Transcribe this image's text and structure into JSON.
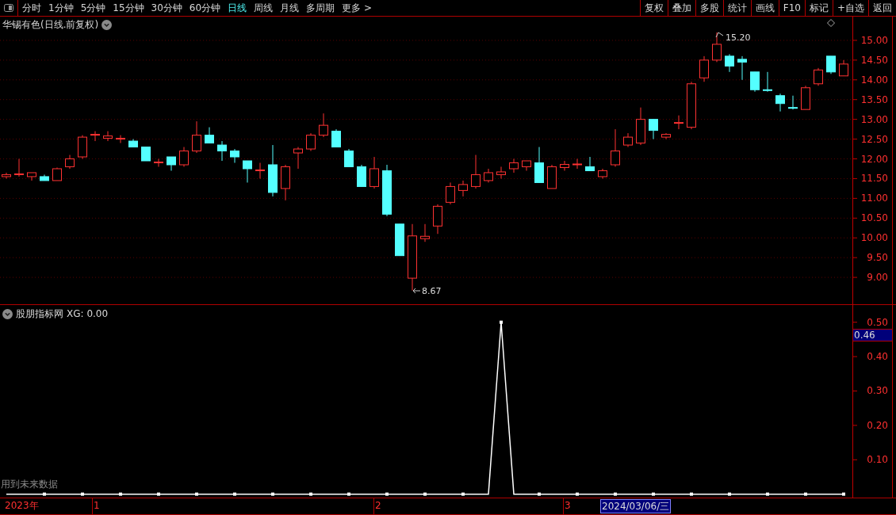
{
  "toolbar": {
    "periods": [
      {
        "label": "分时",
        "selected": false
      },
      {
        "label": "1分钟",
        "selected": false
      },
      {
        "label": "5分钟",
        "selected": false
      },
      {
        "label": "15分钟",
        "selected": false
      },
      {
        "label": "30分钟",
        "selected": false
      },
      {
        "label": "60分钟",
        "selected": false
      },
      {
        "label": "日线",
        "selected": true
      },
      {
        "label": "周线",
        "selected": false
      },
      {
        "label": "月线",
        "selected": false
      },
      {
        "label": "多周期",
        "selected": false
      },
      {
        "label": "更多 >",
        "selected": false
      }
    ],
    "buttons": [
      "复权",
      "叠加",
      "多股",
      "统计",
      "画线",
      "F10",
      "标记",
      "+自选",
      "返回"
    ]
  },
  "main_chart": {
    "title": "华锡有色(日线.前复权)",
    "high_label": "15.20",
    "low_label": "8.67",
    "chart_data": {
      "type": "candlestick",
      "ylim": [
        8.3,
        15.6
      ],
      "yticks": [
        {
          "value": 15,
          "label": "15.00"
        },
        {
          "value": 14.5,
          "label": "14.50"
        },
        {
          "value": 14,
          "label": "14.00"
        },
        {
          "value": 13.5,
          "label": "13.50"
        },
        {
          "value": 13,
          "label": "13.00"
        },
        {
          "value": 12.5,
          "label": "12.50"
        },
        {
          "value": 12,
          "label": "12.00"
        },
        {
          "value": 11.5,
          "label": "11.50"
        },
        {
          "value": 11,
          "label": "11.00"
        },
        {
          "value": 10.5,
          "label": "10.50"
        },
        {
          "value": 10,
          "label": "10.00"
        },
        {
          "value": 9.5,
          "label": "9.50"
        },
        {
          "value": 9,
          "label": "9.00"
        }
      ],
      "grid": true,
      "ohlc": [
        [
          11.55,
          11.65,
          11.5,
          11.6
        ],
        [
          11.6,
          12.0,
          11.55,
          11.62
        ],
        [
          11.55,
          11.65,
          11.45,
          11.65
        ],
        [
          11.55,
          11.6,
          11.45,
          11.45
        ],
        [
          11.45,
          11.78,
          11.45,
          11.75
        ],
        [
          11.8,
          12.1,
          11.75,
          12.0
        ],
        [
          12.05,
          12.6,
          12.0,
          12.55
        ],
        [
          12.6,
          12.7,
          12.45,
          12.62
        ],
        [
          12.52,
          12.7,
          12.45,
          12.58
        ],
        [
          12.5,
          12.6,
          12.4,
          12.52
        ],
        [
          12.45,
          12.5,
          12.3,
          12.3
        ],
        [
          12.3,
          12.3,
          11.95,
          11.95
        ],
        [
          11.9,
          12.0,
          11.8,
          11.92
        ],
        [
          12.05,
          12.05,
          11.7,
          11.85
        ],
        [
          11.85,
          12.3,
          11.8,
          12.2
        ],
        [
          12.2,
          12.95,
          12.15,
          12.6
        ],
        [
          12.6,
          12.8,
          12.4,
          12.4
        ],
        [
          12.35,
          12.45,
          11.95,
          12.2
        ],
        [
          12.2,
          12.25,
          11.9,
          12.05
        ],
        [
          11.95,
          11.95,
          11.4,
          11.75
        ],
        [
          11.7,
          11.9,
          11.5,
          11.72
        ],
        [
          11.85,
          12.35,
          11.05,
          11.15
        ],
        [
          11.25,
          11.85,
          10.95,
          11.8
        ],
        [
          12.15,
          12.3,
          11.75,
          12.25
        ],
        [
          12.25,
          12.65,
          12.2,
          12.6
        ],
        [
          12.6,
          13.15,
          12.55,
          12.85
        ],
        [
          12.7,
          12.75,
          12.3,
          12.3
        ],
        [
          12.2,
          12.25,
          11.8,
          11.8
        ],
        [
          11.8,
          11.85,
          11.3,
          11.3
        ],
        [
          11.3,
          12.05,
          11.25,
          11.75
        ],
        [
          11.7,
          11.85,
          10.55,
          10.6
        ],
        [
          10.35,
          10.35,
          9.55,
          9.55
        ],
        [
          8.98,
          10.35,
          8.67,
          10.05
        ],
        [
          9.98,
          10.35,
          9.9,
          10.04
        ],
        [
          10.3,
          10.85,
          10.1,
          10.8
        ],
        [
          10.9,
          11.4,
          10.85,
          11.3
        ],
        [
          11.2,
          11.45,
          11.05,
          11.35
        ],
        [
          11.3,
          12.1,
          11.25,
          11.6
        ],
        [
          11.45,
          11.75,
          11.4,
          11.65
        ],
        [
          11.6,
          11.8,
          11.5,
          11.67
        ],
        [
          11.75,
          12.0,
          11.65,
          11.9
        ],
        [
          11.8,
          11.95,
          11.7,
          11.95
        ],
        [
          11.9,
          12.3,
          11.4,
          11.4
        ],
        [
          11.25,
          11.85,
          11.25,
          11.8
        ],
        [
          11.78,
          11.95,
          11.7,
          11.86
        ],
        [
          11.85,
          12.0,
          11.75,
          11.87
        ],
        [
          11.8,
          12.05,
          11.7,
          11.7
        ],
        [
          11.55,
          11.75,
          11.5,
          11.7
        ],
        [
          11.85,
          12.75,
          11.8,
          12.2
        ],
        [
          12.35,
          12.65,
          12.3,
          12.55
        ],
        [
          12.4,
          13.3,
          12.35,
          13.0
        ],
        [
          13.0,
          13.0,
          12.5,
          12.72
        ],
        [
          12.55,
          12.65,
          12.5,
          12.62
        ],
        [
          12.9,
          13.1,
          12.75,
          12.92
        ],
        [
          12.8,
          13.95,
          12.75,
          13.9
        ],
        [
          14.05,
          14.6,
          13.95,
          14.5
        ],
        [
          14.5,
          15.2,
          14.45,
          14.9
        ],
        [
          14.6,
          14.65,
          14.2,
          14.35
        ],
        [
          14.52,
          14.6,
          14.0,
          14.45
        ],
        [
          14.2,
          14.2,
          13.7,
          13.75
        ],
        [
          13.75,
          14.2,
          13.7,
          13.73
        ],
        [
          13.6,
          13.65,
          13.2,
          13.4
        ],
        [
          13.3,
          13.6,
          13.25,
          13.28
        ],
        [
          13.25,
          13.85,
          13.25,
          13.8
        ],
        [
          13.9,
          14.3,
          13.85,
          14.25
        ],
        [
          14.6,
          14.6,
          14.15,
          14.2
        ],
        [
          14.1,
          14.5,
          14.1,
          14.4
        ]
      ]
    }
  },
  "indicator": {
    "title": "股朋指标网",
    "reading": "XG: 0.00",
    "current_value": "0.46",
    "warning": "用到未来数据",
    "chart_data": {
      "type": "line",
      "ylim": [
        -0.01,
        0.55
      ],
      "yticks": [
        {
          "value": 0.1,
          "label": "0.10"
        },
        {
          "value": 0.2,
          "label": "0.20"
        },
        {
          "value": 0.3,
          "label": "0.30"
        },
        {
          "value": 0.4,
          "label": "0.40"
        },
        {
          "value": 0.5,
          "label": "0.50"
        }
      ],
      "series": [
        {
          "color": "#ffffff",
          "values": [
            0,
            0,
            0,
            0,
            0,
            0,
            0,
            0,
            0,
            0,
            0,
            0,
            0,
            0,
            0,
            0,
            0,
            0,
            0,
            0,
            0,
            0,
            0,
            0,
            0,
            0,
            0,
            0,
            0,
            0,
            0,
            0,
            0,
            0,
            0,
            0,
            0,
            0,
            0,
            0.5,
            0,
            0,
            0,
            0,
            0,
            0,
            0,
            0,
            0,
            0,
            0,
            0,
            0,
            0,
            0,
            0,
            0,
            0,
            0,
            0,
            0,
            0,
            0,
            0,
            0,
            0,
            0
          ]
        }
      ]
    }
  },
  "time_axis": {
    "labels": [
      {
        "text": "2023年",
        "selected": false
      },
      {
        "text": "1",
        "selected": false
      },
      {
        "text": "2",
        "selected": false
      },
      {
        "text": "3",
        "selected": false
      },
      {
        "text": "2024/03/06/三",
        "selected": true
      }
    ]
  }
}
